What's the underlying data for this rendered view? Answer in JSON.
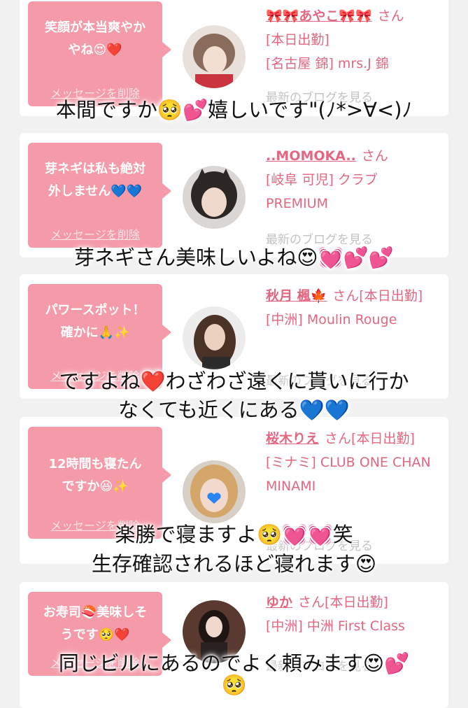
{
  "items": [
    {
      "bubble_text": "笑顔が本当爽やか\nやね😍❤️",
      "delete_label": "メッセージを削除",
      "name": "🎀🎀あやこ🎀🎀",
      "san": "さん",
      "status": "[本日出勤]",
      "shop": "[名古屋 錦] mrs.J 錦",
      "blog": "最新のブログを見る",
      "caption_lines": [
        "本間ですか🥺💕嬉しいです\"(ﾉ*>∀<)ﾉ"
      ]
    },
    {
      "bubble_text": "芽ネギは私も絶対\n外しません💙💙",
      "delete_label": "メッセージを削除",
      "name": "..MOMOKA..",
      "san": "さん",
      "status": "",
      "shop": "[岐阜 可児] クラブ PREMIUM",
      "blog": "最新のブログを見る",
      "caption_lines": [
        "芽ネギさん美味しいよね😍💓💕💕"
      ]
    },
    {
      "bubble_text": "パワースポット！\n確かに🙏✨",
      "delete_label": "メッセージを削除",
      "name": "秋月 楓🍁",
      "san": "さん",
      "status": "[本日出勤]",
      "shop": "[中洲] Moulin Rouge",
      "blog": "最新のブログを見る",
      "caption_lines": [
        "ですよね❤️わざわざ遠くに貰いに行か",
        "なくても近くにある💙💙"
      ]
    },
    {
      "bubble_text": "12時間も寝たん\nですか😆✨",
      "delete_label": "メッセージを削除",
      "name": "桜木りえ",
      "san": "さん",
      "status": "[本日出勤]",
      "shop": "[ミナミ] CLUB ONE CHAN MINAMI",
      "blog": "最新のブログを見る",
      "caption_lines": [
        "楽勝で寝ますよ🥺💓💓笑",
        "生存確認されるほど寝れます😍"
      ]
    },
    {
      "bubble_text": "お寿司🍣美味しそ\nうです🥺❤️",
      "delete_label": "メッセージを削除",
      "name": "ゆか",
      "san": "さん",
      "status": "[本日出勤]",
      "shop": "[中洲] 中洲 First Class",
      "blog": "最新のブログを見る",
      "caption_lines": [
        "同じビルにあるのでよく頼みます😍💕",
        "🥺"
      ]
    }
  ]
}
